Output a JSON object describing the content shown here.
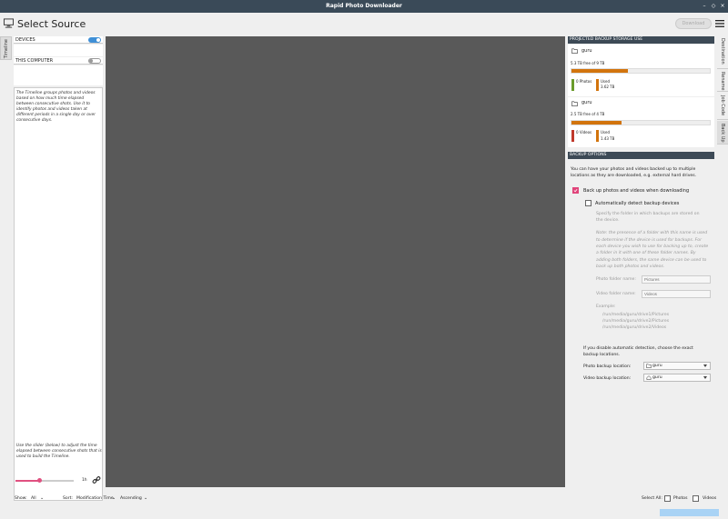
{
  "window": {
    "title": "Rapid Photo Downloader",
    "min": "–",
    "max": "◇",
    "close": "×"
  },
  "header": {
    "title": "Select Source",
    "download_label": "Download"
  },
  "left_tabs": {
    "timeline": "Timeline"
  },
  "left": {
    "devices_label": "DEVICES",
    "this_computer_label": "THIS COMPUTER",
    "devices_on": true,
    "this_computer_on": false,
    "timeline_help": "The Timeline groups photos and videos based on how much time elapsed between consecutive shots. Use it to identify photos and videos taken at different periods in a single day or over consecutive days.",
    "slider_help": "Use the slider (below) to adjust the time elapsed between consecutive shots that is used to build the Timeline.",
    "slider_value": "1h",
    "slider_fraction": 0.42
  },
  "right_tabs": [
    "Destination",
    "Rename",
    "Job Code",
    "Back Up"
  ],
  "storage": {
    "heading": "PROJECTED BACKUP STORAGE USE",
    "photos": {
      "device": "guru",
      "free": "5.3 TB free of 9 TB",
      "fraction": 0.41,
      "legend1": "0 Photos",
      "legend2_title": "Used",
      "legend2_value": "3.62 TB",
      "color1": "#6a9b2b",
      "color2": "#d2740d"
    },
    "videos": {
      "device": "guru",
      "free": "2.5 TB free of 4 TB",
      "fraction": 0.36,
      "legend1": "0 Videos",
      "legend2_title": "Used",
      "legend2_value": "1.43 TB",
      "color1": "#c0392b",
      "color2": "#d2740d"
    }
  },
  "backup": {
    "heading": "BACKUP OPTIONS",
    "intro": [
      "You can have your photos and videos backed up to multiple",
      "locations as they are downloaded, e.g. external hard drives."
    ],
    "backup_when_downloading": "Back up photos and videos when downloading",
    "auto_detect": "Automatically detect backup devices",
    "specify": [
      "Specify the folder in which backups are stored on",
      "the device."
    ],
    "note": [
      "Note: the presence of a folder with this name is used",
      "to determine if the device is used for backups. For",
      "each device you wish to use for backing up to, create",
      "a folder in it with one of these folder names. By",
      "adding both folders, the same device can be used to",
      "back up both photos and videos."
    ],
    "photo_folder_label": "Photo folder name:",
    "photo_folder_placeholder": "Pictures",
    "video_folder_label": "Video folder name:",
    "video_folder_placeholder": "Videos",
    "example_label": "Example:",
    "example_paths": [
      "/run/media/guru/drive1/Pictures",
      "/run/media/guru/drive2/Pictures",
      "/run/media/guru/drive2/Videos"
    ],
    "disable_text": [
      "If you disable automatic detection, choose the exact",
      "backup locations."
    ],
    "photo_location_label": "Photo backup location:",
    "photo_location_value": "guru",
    "video_location_label": "Video backup location:",
    "video_location_value": "guru"
  },
  "bottom": {
    "show_label": "Show:",
    "show_value": "All",
    "sort_label": "Sort:",
    "sort_value": "Modification Time",
    "order_value": "Ascending",
    "select_all_label": "Select All:",
    "photos_label": "Photos",
    "videos_label": "Videos"
  }
}
